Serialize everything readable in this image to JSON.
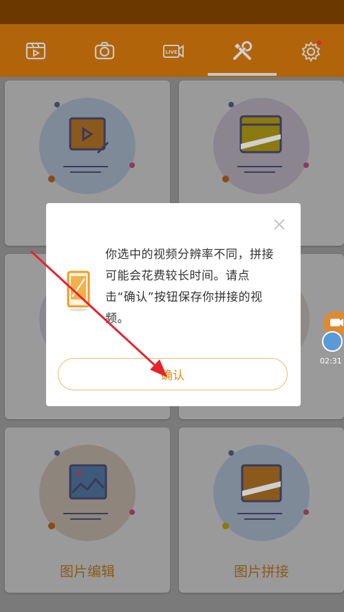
{
  "tabs": [
    {
      "name": "video-edit",
      "icon": "film-play-icon"
    },
    {
      "name": "camera",
      "icon": "camera-icon"
    },
    {
      "name": "live",
      "icon": "live-camera-icon"
    },
    {
      "name": "tools",
      "icon": "tools-icon",
      "active": true
    },
    {
      "name": "settings",
      "icon": "gear-icon",
      "badge": true
    }
  ],
  "cards": [
    {
      "label": ""
    },
    {
      "label": ""
    },
    {
      "label": ""
    },
    {
      "label": ""
    },
    {
      "label": "图片编辑"
    },
    {
      "label": "图片拼接"
    }
  ],
  "dialog": {
    "message": "你选中的视频分辨率不同，拼接可能会花费较长时间。请点击“确认”按钮保存你拼接的视频。",
    "confirm_label": "确认",
    "icon": "phone-icon"
  },
  "float_widget": {
    "time": "02:31"
  },
  "colors": {
    "accent": "#e88a10",
    "tabbar": "#b2640a",
    "statusbar": "#6b3900"
  }
}
